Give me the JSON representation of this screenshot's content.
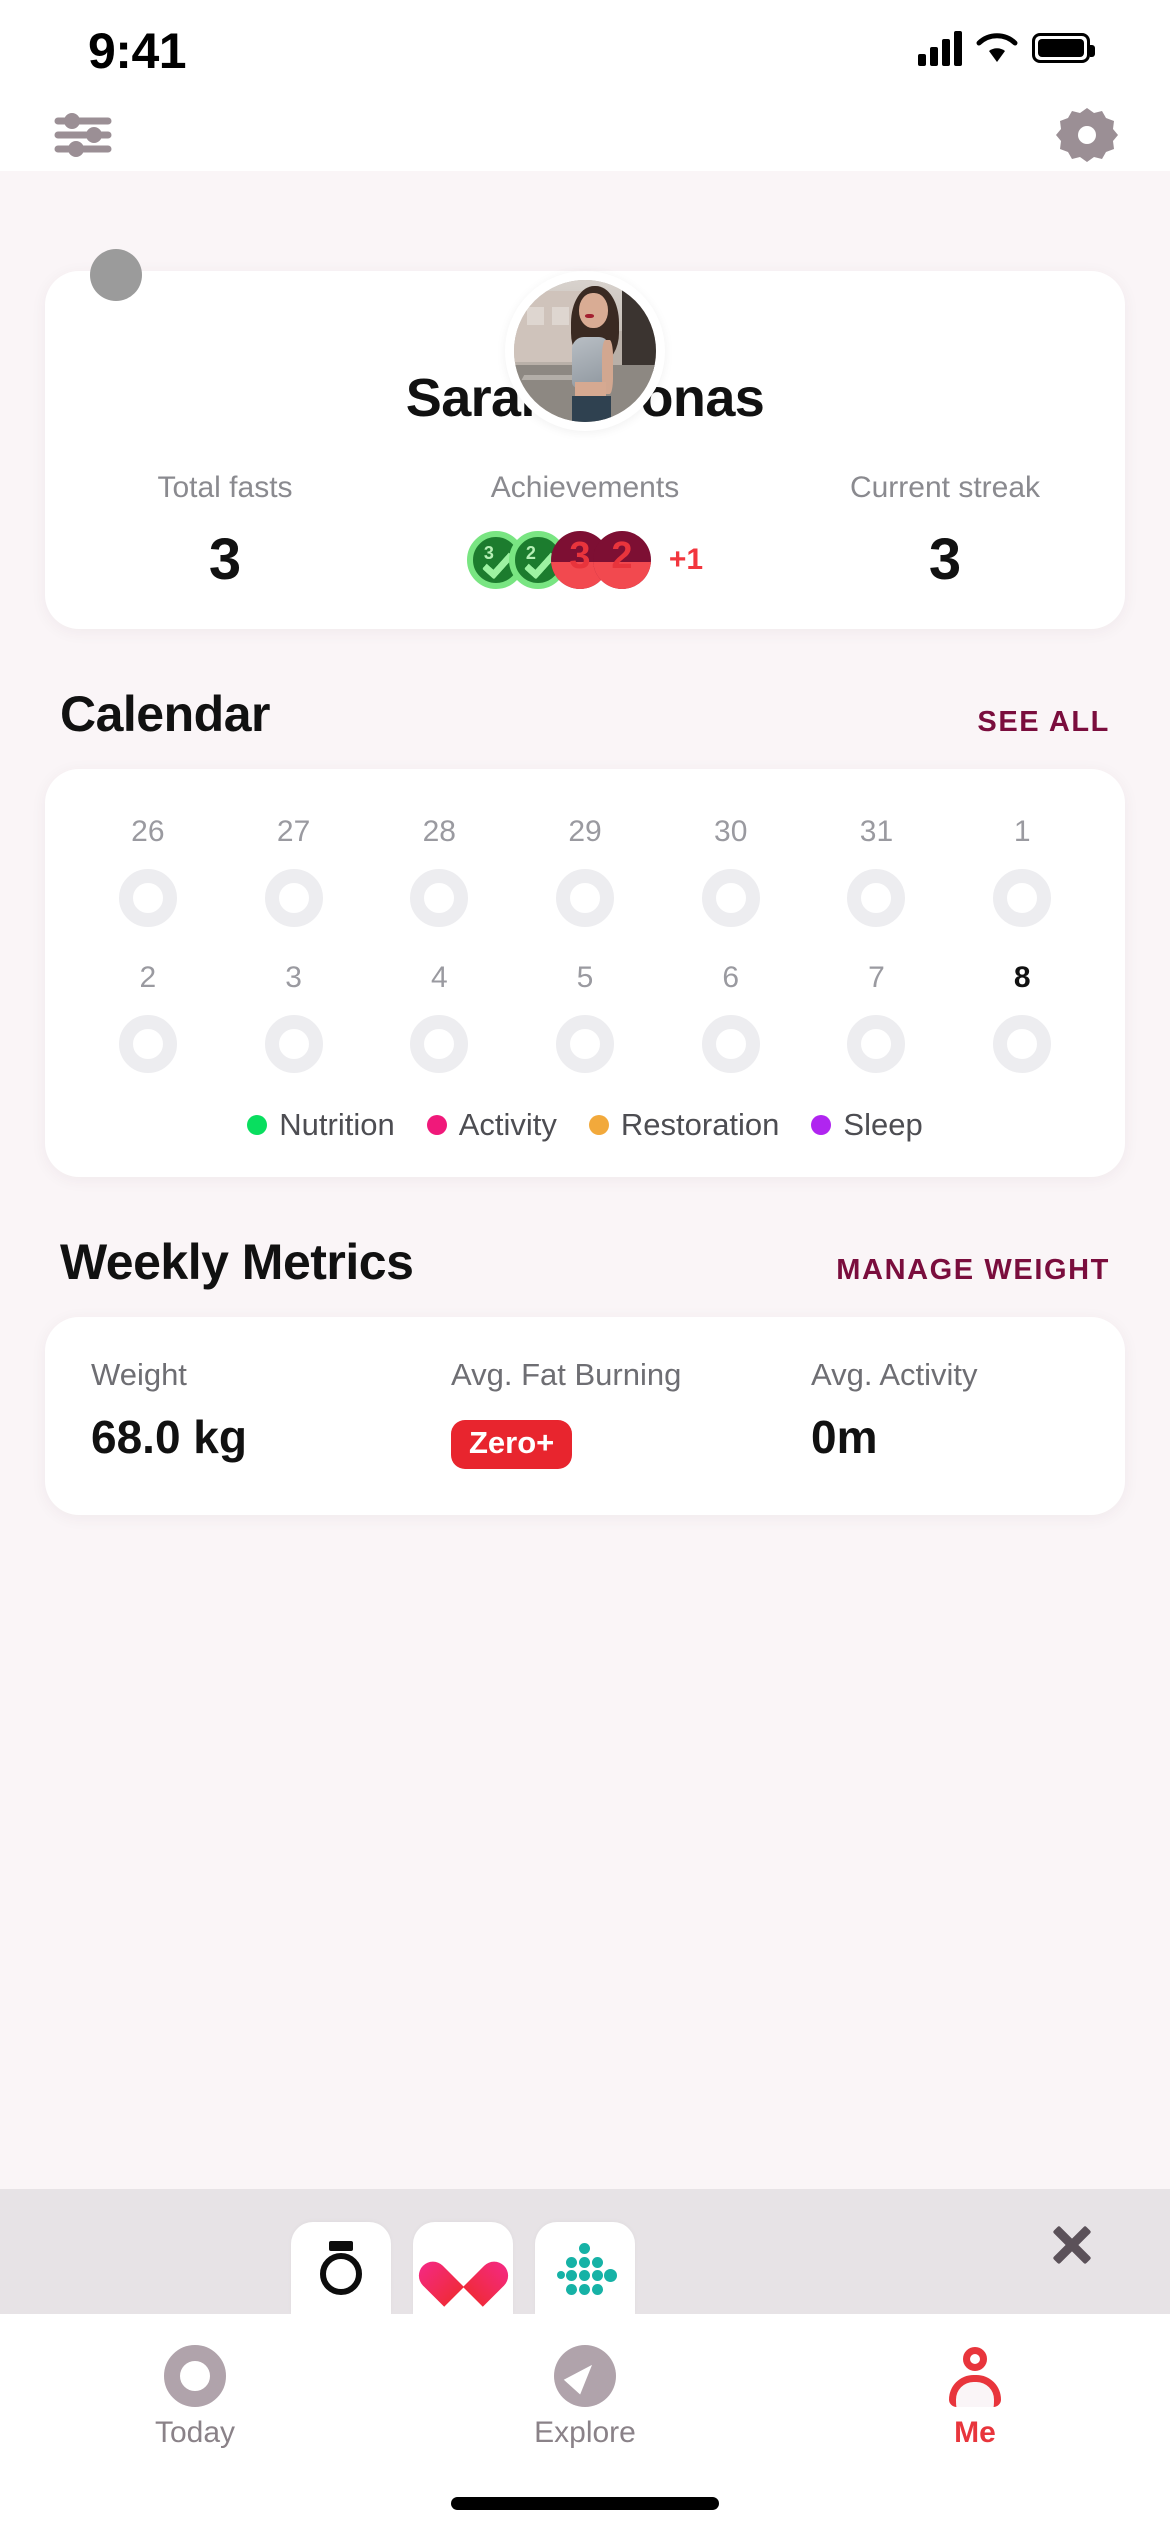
{
  "status_bar": {
    "time": "9:41",
    "signal_icon": "cellular-bars-icon",
    "wifi_icon": "wifi-icon",
    "battery_icon": "battery-full-icon"
  },
  "nav_bar": {
    "left_icon": "sliders-filter-icon",
    "right_icon": "gear-settings-icon"
  },
  "profile": {
    "avatar_icon": "user-avatar-photo",
    "corner_badge_icon": "gray-circle-badge",
    "name": "Sarah J Jonas",
    "stats": [
      {
        "label": "Total fasts",
        "value": "3"
      },
      {
        "label": "Achievements",
        "value": ""
      },
      {
        "label": "Current streak",
        "value": "3"
      }
    ],
    "achievements": {
      "badges": [
        {
          "type": "green",
          "number": "3"
        },
        {
          "type": "green",
          "number": "2"
        },
        {
          "type": "red",
          "number": "3"
        },
        {
          "type": "red",
          "number": "2"
        }
      ],
      "more": "+1",
      "more_color": "#f2363e"
    }
  },
  "calendar": {
    "title": "Calendar",
    "see_all": "SEE ALL",
    "weeks": [
      [
        "26",
        "27",
        "28",
        "29",
        "30",
        "31",
        "1"
      ],
      [
        "2",
        "3",
        "4",
        "5",
        "6",
        "7",
        "8"
      ]
    ],
    "today": "8",
    "legend": [
      {
        "label": "Nutrition",
        "color": "#09de5f"
      },
      {
        "label": "Activity",
        "color": "#f0197a"
      },
      {
        "label": "Restoration",
        "color": "#f2a93b"
      },
      {
        "label": "Sleep",
        "color": "#b025f0"
      }
    ]
  },
  "weekly_metrics": {
    "title": "Weekly Metrics",
    "manage_link": "MANAGE WEIGHT",
    "items": [
      {
        "label": "Weight",
        "value": "68.0 kg",
        "type": "text"
      },
      {
        "label": "Avg. Fat Burning",
        "value": "Zero+",
        "type": "pill",
        "pill_color": "#e8252e"
      },
      {
        "label": "Avg. Activity",
        "value": "0m",
        "type": "text"
      }
    ]
  },
  "tray": {
    "tiles": [
      {
        "icon": "stopwatch-timer-icon"
      },
      {
        "icon": "heart-health-icon"
      },
      {
        "icon": "fitbit-dots-icon"
      }
    ],
    "close_icon": "close-x-icon"
  },
  "tab_bar": {
    "tabs": [
      {
        "label": "Today",
        "icon": "today-circle-icon",
        "active": false
      },
      {
        "label": "Explore",
        "icon": "explore-compass-icon",
        "active": false
      },
      {
        "label": "Me",
        "icon": "me-person-icon",
        "active": true
      }
    ],
    "active_color": "#e8353c"
  }
}
